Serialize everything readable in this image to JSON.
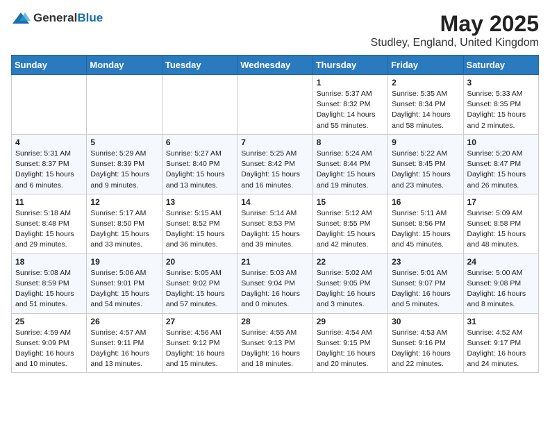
{
  "header": {
    "logo_general": "General",
    "logo_blue": "Blue",
    "month_title": "May 2025",
    "location": "Studley, England, United Kingdom"
  },
  "days_of_week": [
    "Sunday",
    "Monday",
    "Tuesday",
    "Wednesday",
    "Thursday",
    "Friday",
    "Saturday"
  ],
  "weeks": [
    [
      {
        "day": "",
        "info": ""
      },
      {
        "day": "",
        "info": ""
      },
      {
        "day": "",
        "info": ""
      },
      {
        "day": "",
        "info": ""
      },
      {
        "day": "1",
        "info": "Sunrise: 5:37 AM\nSunset: 8:32 PM\nDaylight: 14 hours and 55 minutes."
      },
      {
        "day": "2",
        "info": "Sunrise: 5:35 AM\nSunset: 8:34 PM\nDaylight: 14 hours and 58 minutes."
      },
      {
        "day": "3",
        "info": "Sunrise: 5:33 AM\nSunset: 8:35 PM\nDaylight: 15 hours and 2 minutes."
      }
    ],
    [
      {
        "day": "4",
        "info": "Sunrise: 5:31 AM\nSunset: 8:37 PM\nDaylight: 15 hours and 6 minutes."
      },
      {
        "day": "5",
        "info": "Sunrise: 5:29 AM\nSunset: 8:39 PM\nDaylight: 15 hours and 9 minutes."
      },
      {
        "day": "6",
        "info": "Sunrise: 5:27 AM\nSunset: 8:40 PM\nDaylight: 15 hours and 13 minutes."
      },
      {
        "day": "7",
        "info": "Sunrise: 5:25 AM\nSunset: 8:42 PM\nDaylight: 15 hours and 16 minutes."
      },
      {
        "day": "8",
        "info": "Sunrise: 5:24 AM\nSunset: 8:44 PM\nDaylight: 15 hours and 19 minutes."
      },
      {
        "day": "9",
        "info": "Sunrise: 5:22 AM\nSunset: 8:45 PM\nDaylight: 15 hours and 23 minutes."
      },
      {
        "day": "10",
        "info": "Sunrise: 5:20 AM\nSunset: 8:47 PM\nDaylight: 15 hours and 26 minutes."
      }
    ],
    [
      {
        "day": "11",
        "info": "Sunrise: 5:18 AM\nSunset: 8:48 PM\nDaylight: 15 hours and 29 minutes."
      },
      {
        "day": "12",
        "info": "Sunrise: 5:17 AM\nSunset: 8:50 PM\nDaylight: 15 hours and 33 minutes."
      },
      {
        "day": "13",
        "info": "Sunrise: 5:15 AM\nSunset: 8:52 PM\nDaylight: 15 hours and 36 minutes."
      },
      {
        "day": "14",
        "info": "Sunrise: 5:14 AM\nSunset: 8:53 PM\nDaylight: 15 hours and 39 minutes."
      },
      {
        "day": "15",
        "info": "Sunrise: 5:12 AM\nSunset: 8:55 PM\nDaylight: 15 hours and 42 minutes."
      },
      {
        "day": "16",
        "info": "Sunrise: 5:11 AM\nSunset: 8:56 PM\nDaylight: 15 hours and 45 minutes."
      },
      {
        "day": "17",
        "info": "Sunrise: 5:09 AM\nSunset: 8:58 PM\nDaylight: 15 hours and 48 minutes."
      }
    ],
    [
      {
        "day": "18",
        "info": "Sunrise: 5:08 AM\nSunset: 8:59 PM\nDaylight: 15 hours and 51 minutes."
      },
      {
        "day": "19",
        "info": "Sunrise: 5:06 AM\nSunset: 9:01 PM\nDaylight: 15 hours and 54 minutes."
      },
      {
        "day": "20",
        "info": "Sunrise: 5:05 AM\nSunset: 9:02 PM\nDaylight: 15 hours and 57 minutes."
      },
      {
        "day": "21",
        "info": "Sunrise: 5:03 AM\nSunset: 9:04 PM\nDaylight: 16 hours and 0 minutes."
      },
      {
        "day": "22",
        "info": "Sunrise: 5:02 AM\nSunset: 9:05 PM\nDaylight: 16 hours and 3 minutes."
      },
      {
        "day": "23",
        "info": "Sunrise: 5:01 AM\nSunset: 9:07 PM\nDaylight: 16 hours and 5 minutes."
      },
      {
        "day": "24",
        "info": "Sunrise: 5:00 AM\nSunset: 9:08 PM\nDaylight: 16 hours and 8 minutes."
      }
    ],
    [
      {
        "day": "25",
        "info": "Sunrise: 4:59 AM\nSunset: 9:09 PM\nDaylight: 16 hours and 10 minutes."
      },
      {
        "day": "26",
        "info": "Sunrise: 4:57 AM\nSunset: 9:11 PM\nDaylight: 16 hours and 13 minutes."
      },
      {
        "day": "27",
        "info": "Sunrise: 4:56 AM\nSunset: 9:12 PM\nDaylight: 16 hours and 15 minutes."
      },
      {
        "day": "28",
        "info": "Sunrise: 4:55 AM\nSunset: 9:13 PM\nDaylight: 16 hours and 18 minutes."
      },
      {
        "day": "29",
        "info": "Sunrise: 4:54 AM\nSunset: 9:15 PM\nDaylight: 16 hours and 20 minutes."
      },
      {
        "day": "30",
        "info": "Sunrise: 4:53 AM\nSunset: 9:16 PM\nDaylight: 16 hours and 22 minutes."
      },
      {
        "day": "31",
        "info": "Sunrise: 4:52 AM\nSunset: 9:17 PM\nDaylight: 16 hours and 24 minutes."
      }
    ]
  ]
}
